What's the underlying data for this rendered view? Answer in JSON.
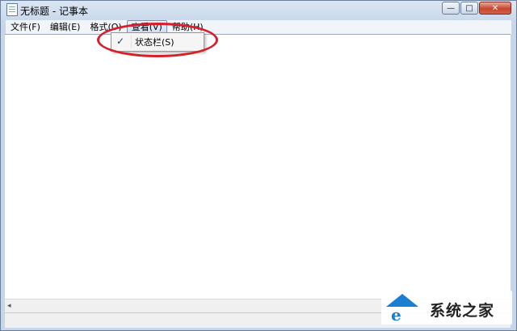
{
  "window": {
    "title": "无标题 - 记事本",
    "controls": {
      "minimize": "—",
      "maximize": "□",
      "close": "✕"
    }
  },
  "menubar": {
    "items": [
      {
        "label": "文件(F)"
      },
      {
        "label": "编辑(E)"
      },
      {
        "label": "格式(O)"
      },
      {
        "label": "查看(V)",
        "active": true
      },
      {
        "label": "帮助(H)"
      }
    ]
  },
  "view_menu": {
    "items": [
      {
        "label": "状态栏(S)",
        "checked": true
      }
    ],
    "check_glyph": "✓"
  },
  "scrollbar": {
    "left_arrow": "◂"
  },
  "watermark": {
    "text": "系统之家",
    "glyph": "e"
  },
  "colors": {
    "highlight": "#d61f2b",
    "menu_active_border": "#7b93b5",
    "watermark_blue": "#1a7fd1"
  }
}
